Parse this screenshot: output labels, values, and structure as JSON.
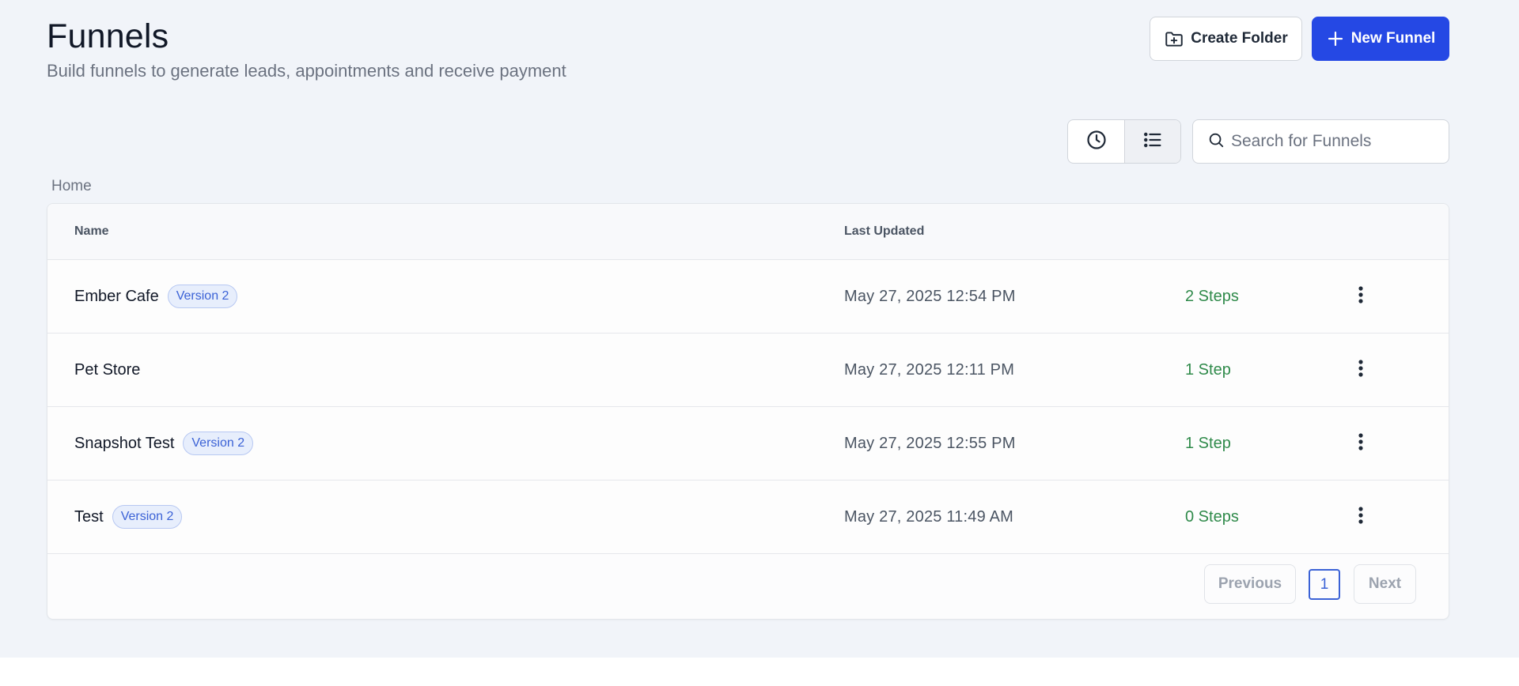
{
  "header": {
    "title": "Funnels",
    "subtitle": "Build funnels to generate leads, appointments and receive payment",
    "create_folder_label": "Create Folder",
    "new_funnel_label": "New Funnel"
  },
  "toolbar": {
    "view_options": [
      "clock-icon",
      "list-icon"
    ],
    "search_placeholder": "Search for Funnels",
    "search_value": ""
  },
  "breadcrumb": "Home",
  "table": {
    "columns": {
      "name": "Name",
      "last_updated": "Last Updated"
    },
    "rows": [
      {
        "name": "Ember Cafe",
        "badge": "Version 2",
        "updated": "May 27, 2025 12:54 PM",
        "steps": "2 Steps"
      },
      {
        "name": "Pet Store",
        "badge": "",
        "updated": "May 27, 2025 12:11 PM",
        "steps": "1 Step"
      },
      {
        "name": "Snapshot Test",
        "badge": "Version 2",
        "updated": "May 27, 2025 12:55 PM",
        "steps": "1 Step"
      },
      {
        "name": "Test",
        "badge": "Version 2",
        "updated": "May 27, 2025 11:49 AM",
        "steps": "0 Steps"
      }
    ]
  },
  "pagination": {
    "previous_label": "Previous",
    "current_page": "1",
    "next_label": "Next"
  },
  "colors": {
    "primary": "#2548e4",
    "badge_text": "#3b62d6",
    "steps_green": "#2f8a4a",
    "background": "#f1f4f9"
  }
}
